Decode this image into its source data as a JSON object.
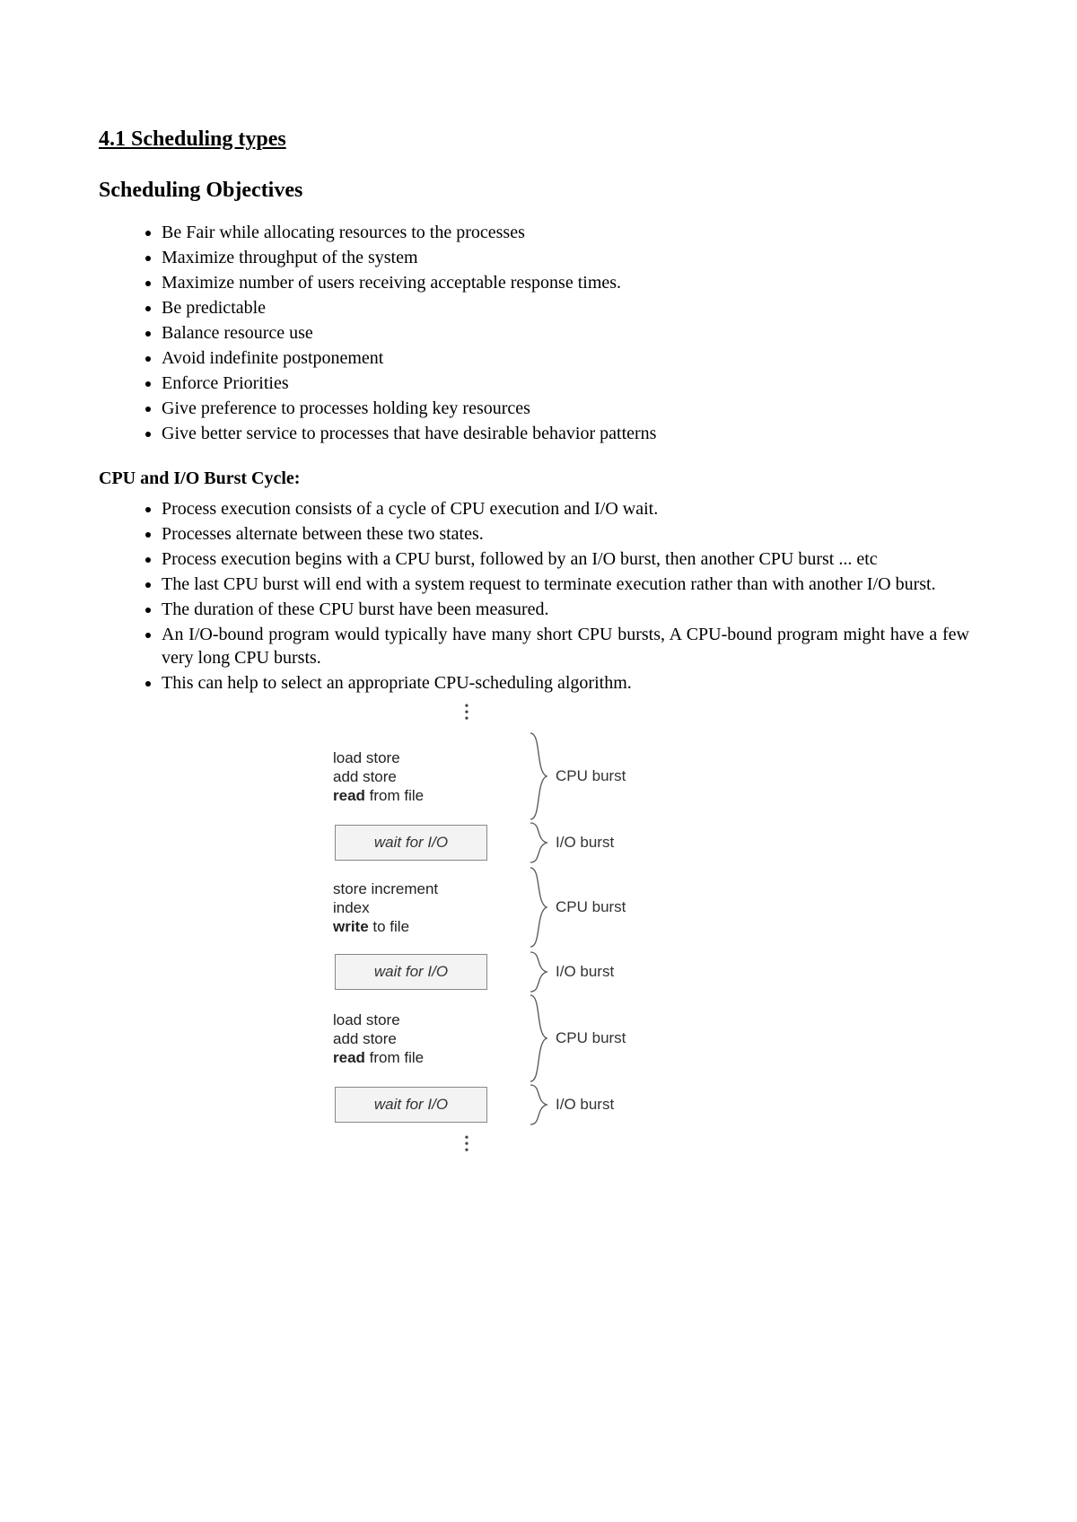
{
  "section_number_title": "4.1 Scheduling types",
  "objectives_heading": "Scheduling Objectives",
  "objectives": [
    "Be Fair while allocating resources to the processes",
    "Maximize throughput of the system",
    "Maximize number of users receiving acceptable response times.",
    "Be predictable",
    "Balance resource use",
    "Avoid indefinite postponement",
    "Enforce Priorities",
    "Give preference to processes holding key resources",
    "Give better service to processes that have desirable behavior patterns"
  ],
  "burst_heading": "CPU and I/O Burst Cycle:",
  "burst_points": [
    "Process execution consists of a cycle of CPU execution and I/O wait.",
    "Processes alternate between these two states.",
    "Process execution begins with a CPU burst, followed by an I/O burst, then another CPU burst ... etc",
    "The last CPU burst will end with a system request to terminate execution rather than with another I/O burst.",
    "The duration of these CPU burst have been measured.",
    "An I/O-bound program would typically have many short CPU bursts, A CPU-bound program might have a few very long CPU bursts.",
    "This can help to select an appropriate CPU-scheduling algorithm."
  ],
  "diagram": {
    "cpu_label": "CPU burst",
    "io_label": "I/O burst",
    "wait_label": "wait for I/O",
    "block1_l1": "load store",
    "block1_l2": "add store",
    "block1_l3_bold": "read",
    "block1_l3_rest": " from file",
    "block2_l1": "store increment",
    "block2_l2": "index",
    "block2_l3_bold": "write",
    "block2_l3_rest": " to file",
    "block3_l1": "load store",
    "block3_l2": "add store",
    "block3_l3_bold": "read",
    "block3_l3_rest": " from file"
  }
}
